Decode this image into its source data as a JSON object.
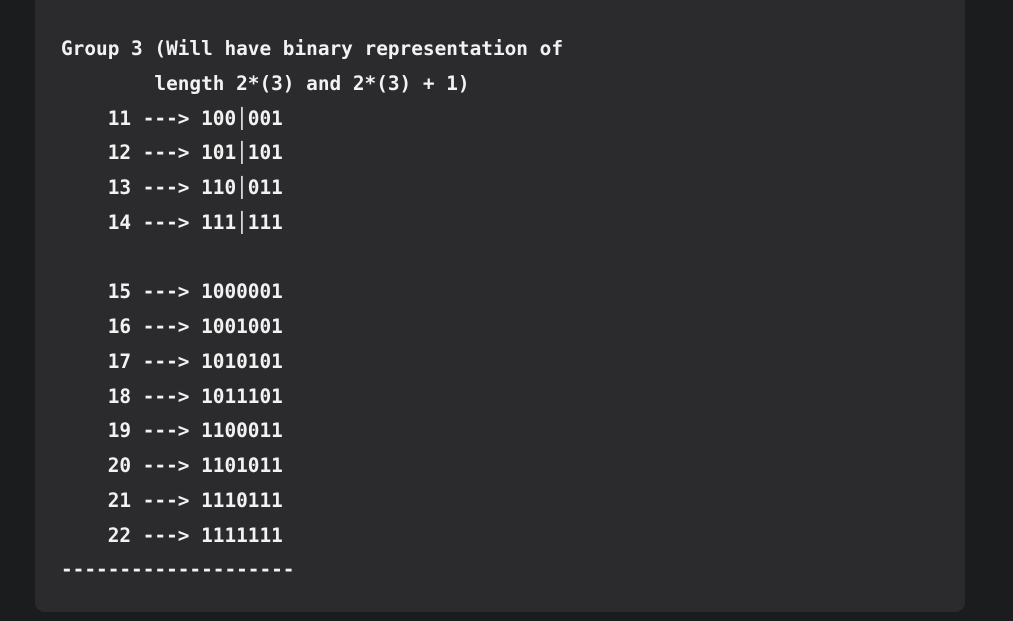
{
  "code_block": {
    "lines": [
      "Group 3 (Will have binary representation of",
      "        length 2*(3) and 2*(3) + 1)",
      "    11 ---> 100│001",
      "    12 ---> 101│101",
      "    13 ---> 110│011",
      "    14 ---> 111│111",
      "",
      "    15 ---> 1000001",
      "    16 ---> 1001001",
      "    17 ---> 1010101",
      "    18 ---> 1011101",
      "    19 ---> 1100011",
      "    20 ---> 1101011",
      "    21 ---> 1110111",
      "    22 ---> 1111111",
      "--------------------"
    ]
  },
  "colors": {
    "page_background": "#1b1c1e",
    "code_background": "#2b2b2d",
    "code_text": "#f2f2f2"
  }
}
